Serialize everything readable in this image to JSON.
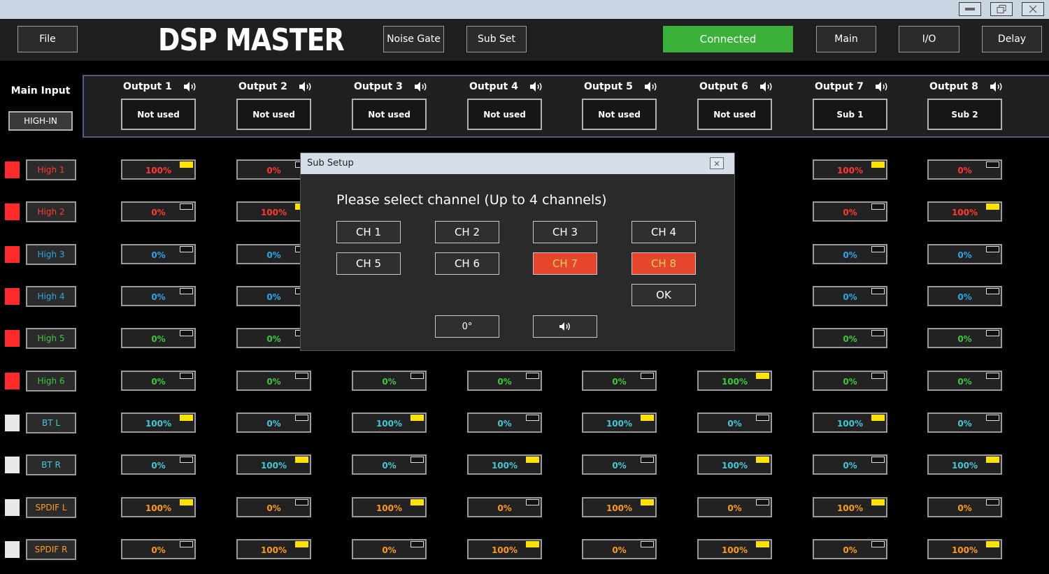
{
  "window": {
    "minimize_icon": "minimize-icon",
    "restore_icon": "restore-icon",
    "close_icon": "close-icon"
  },
  "header": {
    "file_label": "File",
    "app_title": "DSP MASTER",
    "noise_gate_label": "Noise Gate",
    "sub_set_label": "Sub Set",
    "connected_label": "Connected",
    "main_label": "Main",
    "io_label": "I/O",
    "delay_label": "Delay"
  },
  "main_input": {
    "label": "Main Input",
    "value": "HIGH-IN"
  },
  "outputs": [
    {
      "label": "Output 1",
      "assign": "Not used"
    },
    {
      "label": "Output 2",
      "assign": "Not used"
    },
    {
      "label": "Output 3",
      "assign": "Not used"
    },
    {
      "label": "Output 4",
      "assign": "Not used"
    },
    {
      "label": "Output 5",
      "assign": "Not used"
    },
    {
      "label": "Output 6",
      "assign": "Not used"
    },
    {
      "label": "Output 7",
      "assign": "Sub 1"
    },
    {
      "label": "Output 8",
      "assign": "Sub 2"
    }
  ],
  "colors": {
    "red": "#ff3a30",
    "blue": "#2aa8e6",
    "green": "#3ec83e",
    "cyan": "#44c8d8",
    "orange": "#ff9a1e",
    "active_yellow": "#ffe300",
    "connected_green": "#3ab23a",
    "selected_orange": "#e6472c"
  },
  "rows": [
    {
      "label": "High 1",
      "color": "#ff3a30",
      "indicator": "#ff2a2a",
      "values": [
        "100%",
        "0%",
        "",
        "",
        "",
        "",
        "100%",
        "0%"
      ]
    },
    {
      "label": "High 2",
      "color": "#ff3a30",
      "indicator": "#ff2a2a",
      "values": [
        "0%",
        "100%",
        "",
        "",
        "",
        "",
        "0%",
        "100%"
      ]
    },
    {
      "label": "High 3",
      "color": "#2aa8e6",
      "indicator": "#ff2a2a",
      "values": [
        "0%",
        "0%",
        "",
        "",
        "",
        "",
        "0%",
        "0%"
      ]
    },
    {
      "label": "High 4",
      "color": "#2aa8e6",
      "indicator": "#ff2a2a",
      "values": [
        "0%",
        "0%",
        "",
        "",
        "",
        "",
        "0%",
        "0%"
      ]
    },
    {
      "label": "High 5",
      "color": "#3ec83e",
      "indicator": "#ff2a2a",
      "values": [
        "0%",
        "0%",
        "",
        "",
        "",
        "",
        "0%",
        "0%"
      ]
    },
    {
      "label": "High 6",
      "color": "#3ec83e",
      "indicator": "#ff2a2a",
      "values": [
        "0%",
        "0%",
        "0%",
        "0%",
        "0%",
        "100%",
        "0%",
        "0%"
      ]
    },
    {
      "label": "BT L",
      "color": "#44c8d8",
      "indicator": "#e8e8e8",
      "values": [
        "100%",
        "0%",
        "100%",
        "0%",
        "100%",
        "0%",
        "100%",
        "0%"
      ]
    },
    {
      "label": "BT R",
      "color": "#44c8d8",
      "indicator": "#e8e8e8",
      "values": [
        "0%",
        "100%",
        "0%",
        "100%",
        "0%",
        "100%",
        "0%",
        "100%"
      ]
    },
    {
      "label": "SPDIF L",
      "color": "#ff9a1e",
      "indicator": "#e8e8e8",
      "values": [
        "100%",
        "0%",
        "100%",
        "0%",
        "100%",
        "0%",
        "100%",
        "0%"
      ]
    },
    {
      "label": "SPDIF R",
      "color": "#ff9a1e",
      "indicator": "#e8e8e8",
      "values": [
        "0%",
        "100%",
        "0%",
        "100%",
        "0%",
        "100%",
        "0%",
        "100%"
      ]
    }
  ],
  "dialog": {
    "title": "Sub Setup",
    "close_icon": "close-icon",
    "prompt": "Please select channel (Up to 4 channels)",
    "channels": [
      {
        "label": "CH 1",
        "selected": false
      },
      {
        "label": "CH 2",
        "selected": false
      },
      {
        "label": "CH 3",
        "selected": false
      },
      {
        "label": "CH 4",
        "selected": false
      },
      {
        "label": "CH 5",
        "selected": false
      },
      {
        "label": "CH 6",
        "selected": false
      },
      {
        "label": "CH 7",
        "selected": true
      },
      {
        "label": "CH 8",
        "selected": true
      }
    ],
    "ok_label": "OK",
    "phase_label": "0°",
    "speaker_icon": "speaker-icon"
  }
}
